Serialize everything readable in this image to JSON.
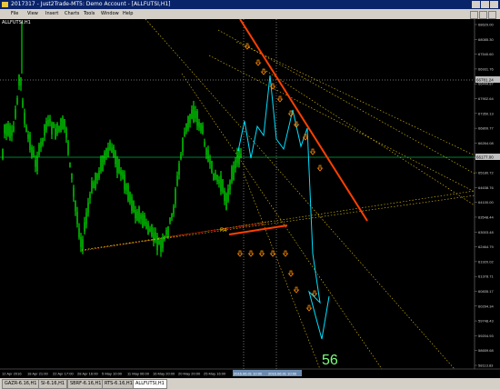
{
  "window": {
    "title": "2017317 - Just2Trade-MT5: Demo Account - [ALLFUTSI,H1]"
  },
  "menu": [
    "File",
    "View",
    "Insert",
    "Charts",
    "Tools",
    "Window",
    "Help"
  ],
  "chart": {
    "symbol_label": "ALLFUTSI,H1",
    "annotation": "56",
    "marker_label": "R4",
    "price_ticks": [
      "68629.00",
      "68085.30",
      "67540.60",
      "66931.76",
      "66444.87",
      "67902.64",
      "67350.13",
      "66809.77",
      "66264.08",
      "65724.58",
      "65180.72",
      "64638.76",
      "64100.00",
      "63548.44",
      "63003.48",
      "62464.79",
      "61920.02",
      "61378.71",
      "60835.17",
      "60294.34",
      "59748.43",
      "59204.93",
      "58659.68",
      "58113.83"
    ],
    "price_badges": {
      "current": "66177.00",
      "highlight": "66781.24"
    },
    "time_ticks": [
      "12 Apr 2016",
      "18 Apr 21:00",
      "22 Apr 17:00",
      "28 Apr 16:00",
      "5 May 10:00",
      "11 May 06:00",
      "16 May 20:00",
      "20 May 20:00",
      "25 May 16:00"
    ],
    "time_badges": [
      "2016.06.01 10:00",
      "2016.06.01 10:00"
    ]
  },
  "tabs": [
    "GAZR-6.16,H1",
    "SI-6.16,H1",
    "SBRF-6.16,H1",
    "RTS-6.16,H1",
    "ALLFUTSI,H1"
  ],
  "active_tab": 4,
  "colors": {
    "background": "#000000",
    "price": "#00ff00",
    "forecast": "#00e0ff",
    "trend": "#ff4000",
    "arrows": "#ff8c00",
    "guides": "#e8c800",
    "annotation": "#7fff7f"
  }
}
